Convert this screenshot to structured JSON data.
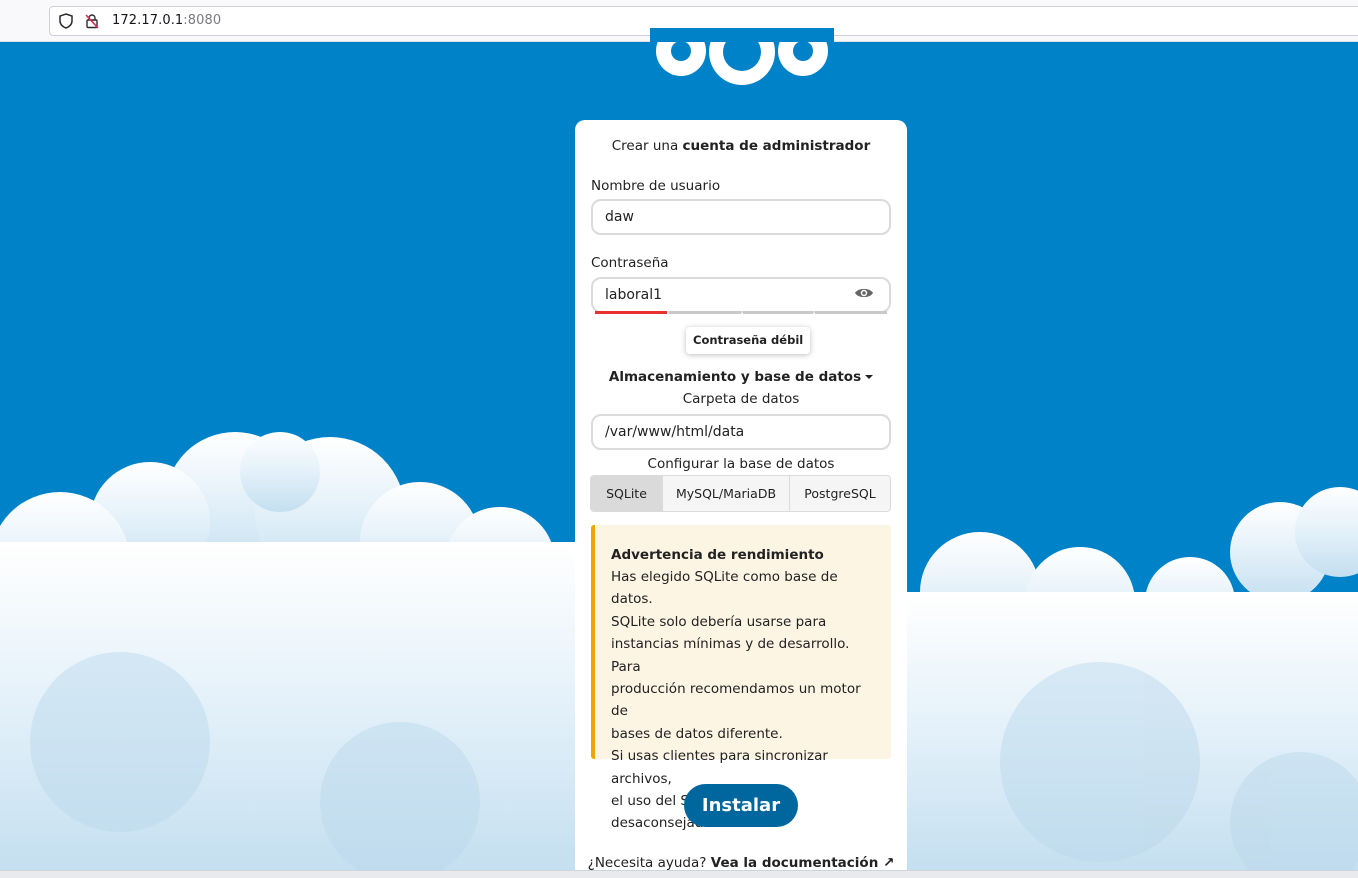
{
  "browser": {
    "url_host": "172.17.0.1",
    "url_port": ":8080",
    "icons": [
      "shield-icon",
      "insecure-lock-icon"
    ]
  },
  "setup": {
    "title_prefix": "Crear una ",
    "title_bold": "cuenta de administrador",
    "username_label": "Nombre de usuario",
    "username_value": "daw",
    "password_label": "Contraseña",
    "password_value": "laboral1",
    "password_strength": {
      "level": 1,
      "of": 4,
      "tooltip": "Contraseña débil"
    },
    "storage_toggle": "Almacenamiento y base de datos",
    "data_folder_label": "Carpeta de datos",
    "data_folder_value": "/var/www/html/data",
    "db_config_label": "Configurar la base de datos",
    "db_tabs": [
      "SQLite",
      "MySQL/MariaDB",
      "PostgreSQL"
    ],
    "db_selected": "SQLite",
    "warning": {
      "title": "Advertencia de rendimiento",
      "lines": [
        "Has elegido SQLite como base de datos.",
        "SQLite solo debería usarse para",
        "instancias mínimas y de desarrollo. Para",
        "producción recomendamos un motor de",
        "bases de datos diferente.",
        "Si usas clientes para sincronizar archivos,",
        "el uso del SQLite está muy",
        "desaconsejado."
      ]
    },
    "install_button": "Instalar",
    "help_prefix": "¿Necesita ayuda? ",
    "help_link": "Vea la documentación ↗"
  },
  "colors": {
    "background": "#0082c9",
    "primary_button": "#00679e",
    "strength_weak": "#e9322d",
    "warning_border": "#eca700",
    "warning_bg": "#fdf5e4"
  }
}
